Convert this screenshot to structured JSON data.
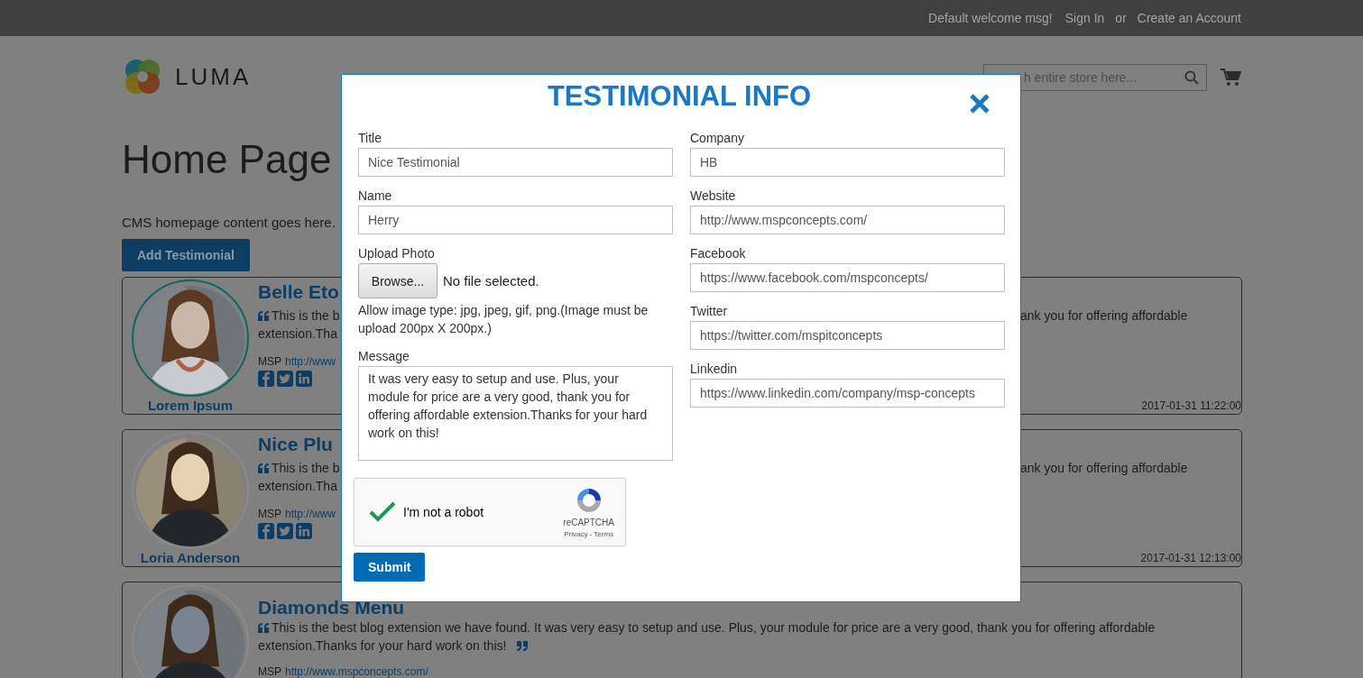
{
  "top_bar": {
    "welcome": "Default welcome msg!",
    "links": [
      {
        "label": "Sign In"
      },
      {
        "label": "Create an Account"
      }
    ],
    "separator": "or"
  },
  "header": {
    "logo_text": "LUMA",
    "search": {
      "placeholder": "h entire store here..."
    }
  },
  "page": {
    "title": "Home Page",
    "intro": "CMS homepage content goes here.",
    "add_button": "Add Testimonial"
  },
  "testimonials": [
    {
      "kind": "split",
      "name": "Lorem Ipsum",
      "highlighted": true,
      "title": "Belle Eto",
      "left_lines": [
        "This is the b",
        "extension.Tha"
      ],
      "right_line": "ank you for offering affordable",
      "msp_label": "MSP",
      "msp_link": "http://www",
      "date": "2017-01-31 11:22:00"
    },
    {
      "kind": "split",
      "name": "Loria Anderson",
      "highlighted": false,
      "title": "Nice Plu",
      "left_lines": [
        "This is the b",
        "extension.Tha"
      ],
      "right_line": "ank you for offering affordable",
      "msp_label": "MSP",
      "msp_link": "http://www",
      "date": "2017-01-31 12:13:00"
    },
    {
      "kind": "full",
      "highlighted": false,
      "title": "Diamonds Menu",
      "lines": [
        "This is the best blog extension we have found. It was very easy to setup and use. Plus, your module for price are a very good, thank you for offering affordable",
        "extension.Thanks for your hard work on this!"
      ],
      "msp_label": "MSP",
      "msp_link": "http://www.mspconcepts.com/"
    }
  ],
  "modal": {
    "title": "TESTIMONIAL INFO",
    "left_fields": [
      {
        "label": "Title",
        "value": "Nice Testimonial"
      },
      {
        "label": "Name",
        "value": "Herry"
      }
    ],
    "upload": {
      "label": "Upload Photo",
      "button": "Browse...",
      "status": "No file selected.",
      "hint": "Allow image type: jpg, jpeg, gif, png.(Image must be upload 200px X 200px.)"
    },
    "message": {
      "label": "Message",
      "value": "It was very easy to setup and use. Plus, your module for price are a very good, thank you for offering affordable extension.Thanks for your hard work on this!"
    },
    "right_fields": [
      {
        "label": "Company",
        "value": "HB"
      },
      {
        "label": "Website",
        "value": "http://www.mspconcepts.com/"
      },
      {
        "label": "Facebook",
        "value": "https://www.facebook.com/mspconcepts/"
      },
      {
        "label": "Twitter",
        "value": "https://twitter.com/mspitconcepts"
      },
      {
        "label": "Linkedin",
        "value": "https://www.linkedin.com/company/msp-concepts"
      }
    ],
    "captcha": {
      "label": "I'm not a robot",
      "checked": true,
      "brand": "reCAPTCHA",
      "links": "Privacy - Terms"
    },
    "submit": "Submit"
  }
}
